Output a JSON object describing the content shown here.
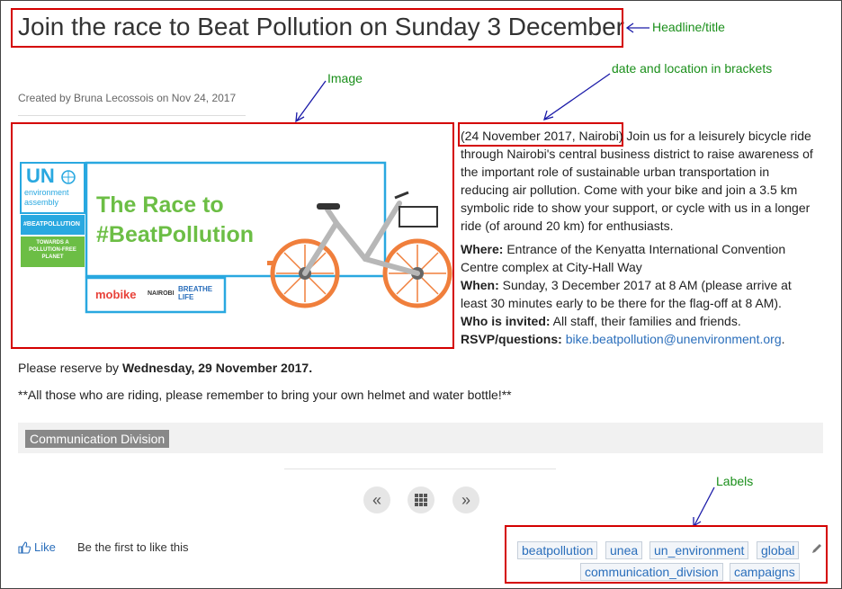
{
  "page": {
    "title": "Join the race to Beat Pollution on Sunday 3 December",
    "meta": "Created by Bruna Lecossois on Nov 24, 2017"
  },
  "annotations": {
    "headline": "Headline/title",
    "date_location": "date and location in brackets",
    "image": "Image",
    "labels": "Labels"
  },
  "poster": {
    "un_text": "UN",
    "env_text": "environment",
    "assembly_text": "assembly",
    "hashtag_small": "#BEATPOLLUTION",
    "towards_text": "TOWARDS A POLLUTION-FREE PLANET",
    "headline_line1": "The Race to",
    "headline_line2": "#BeatPollution",
    "sponsor1": "mobike",
    "sponsor2": "NAIROBI",
    "sponsor3_line1": "BREATHE",
    "sponsor3_line2": "LIFE",
    "colors": {
      "cyan": "#29a8e0",
      "green": "#6cbe45",
      "orange": "#f07f3c"
    }
  },
  "article": {
    "date_location": "(24 November 2017, Nairobi)",
    "intro": " Join us for a leisurely bicycle ride through Nairobi's central business district to raise awareness of the important role of sustainable urban transportation in reducing air pollution. Come with your bike and join a 3.5 km symbolic ride to show your support, or cycle with us in a longer ride (of around 20 km) for enthusiasts.",
    "where_label": "Where:",
    "where_value": " Entrance of the Kenyatta International Convention Centre complex at City-Hall Way",
    "when_label": "When:",
    "when_value": " Sunday, 3 December 2017 at 8 AM (please arrive at least 30 minutes early to be there for the flag-off at 8 AM).",
    "who_label": "Who is invited:",
    "who_value": " All staff, their families and friends.",
    "rsvp_label": "RSVP/questions:",
    "rsvp_link": "bike.beatpollution@unenvironment.org",
    "rsvp_end": "."
  },
  "reserve": {
    "prefix": "Please reserve by ",
    "date": "Wednesday, 29 November 2017."
  },
  "note": "**All those who are riding, please remember to bring your own helmet and water bottle!**",
  "category": "Communication Division",
  "nav": {
    "prev": "«",
    "grid": "grid",
    "next": "»"
  },
  "like": {
    "label": "Like",
    "message": "Be the first to like this"
  },
  "tags": [
    "beatpollution",
    "unea",
    "un_environment",
    "global",
    "communication_division",
    "campaigns"
  ],
  "colors": {
    "annotation_box": "#d40000",
    "annotation_text": "#1a8f1a",
    "arrow": "#1a1aa8",
    "link": "#2a6ebb"
  }
}
